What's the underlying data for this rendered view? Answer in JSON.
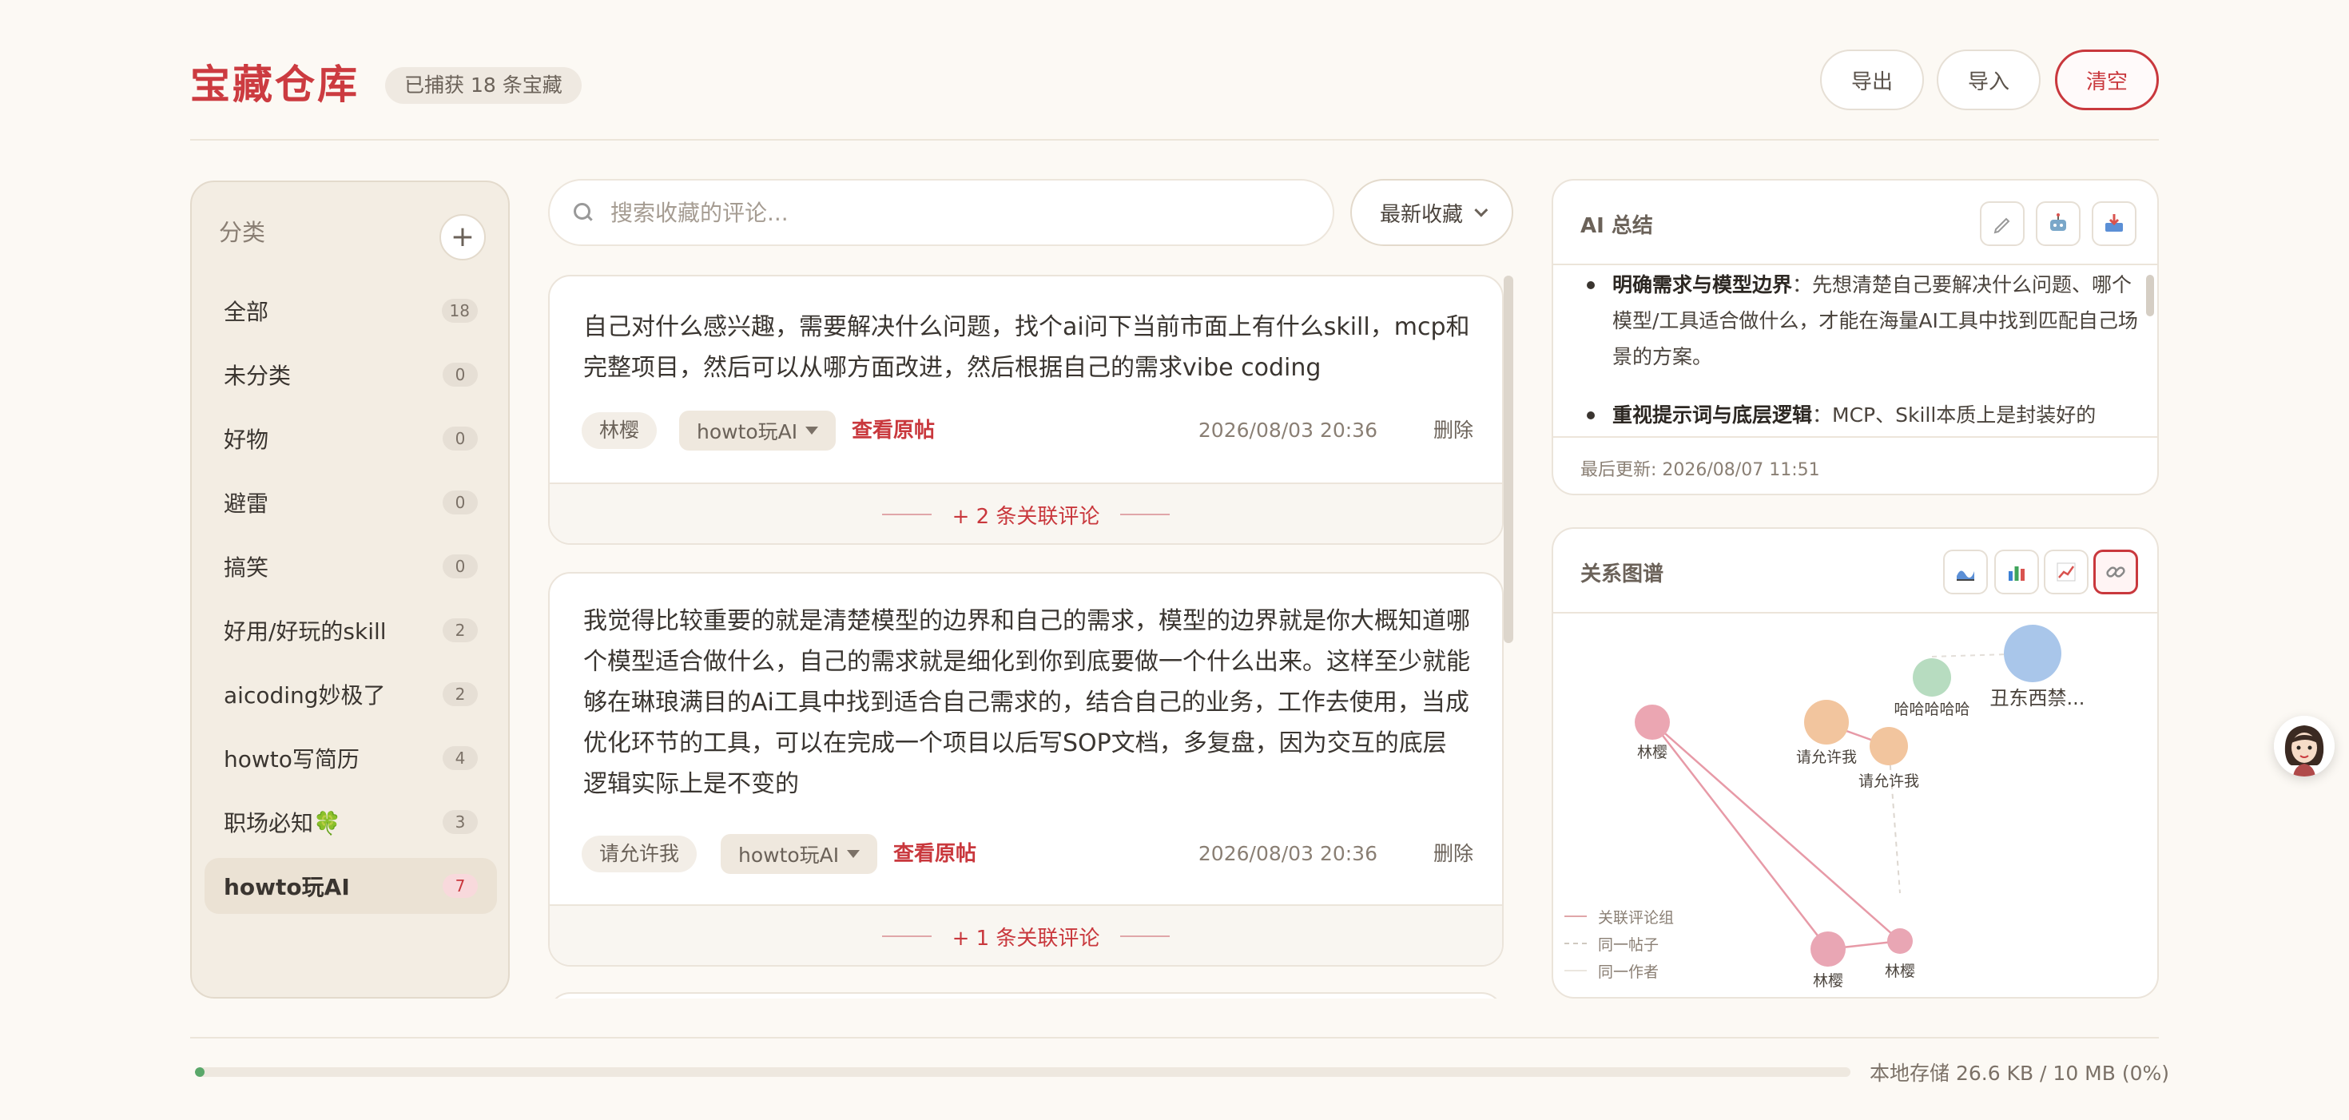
{
  "header": {
    "title": "宝藏仓库",
    "count_badge": "已捕获 18 条宝藏",
    "export_label": "导出",
    "import_label": "导入",
    "clear_label": "清空"
  },
  "sidebar": {
    "heading": "分类",
    "add_label": "+",
    "items": [
      {
        "label": "全部",
        "count": "18"
      },
      {
        "label": "未分类",
        "count": "0"
      },
      {
        "label": "好物",
        "count": "0"
      },
      {
        "label": "避雷",
        "count": "0"
      },
      {
        "label": "搞笑",
        "count": "0"
      },
      {
        "label": "好用/好玩的skill",
        "count": "2"
      },
      {
        "label": "aicoding妙极了",
        "count": "2"
      },
      {
        "label": "howto写简历",
        "count": "4"
      },
      {
        "label": "职场必知🍀",
        "count": "3"
      },
      {
        "label": "howto玩AI",
        "count": "7"
      }
    ],
    "active_index": 9
  },
  "search": {
    "placeholder": "搜索收藏的评论...",
    "value": ""
  },
  "sort": {
    "selected": "最新收藏"
  },
  "cards": [
    {
      "text": "自己对什么感兴趣，需要解决什么问题，找个ai问下当前市面上有什么skill，mcp和完整项目，然后可以从哪方面改进，然后根据自己的需求vibe coding",
      "author": "林樱",
      "category": "howto玩AI",
      "view_label": "查看原帖",
      "time": "2026/08/03 20:36",
      "delete_label": "删除",
      "related_label": "+ 2 条关联评论"
    },
    {
      "text": "我觉得比较重要的就是清楚模型的边界和自己的需求，模型的边界就是你大概知道哪个模型适合做什么，自己的需求就是细化到你到底要做一个什么出来。这样至少就能够在琳琅满目的Ai工具中找到适合自己需求的，结合自己的业务，工作去使用，当成优化环节的工具，可以在完成一个项目以后写SOP文档，多复盘，因为交互的底层逻辑实际上是不变的",
      "author": "请允许我",
      "category": "howto玩AI",
      "view_label": "查看原帖",
      "time": "2026/08/03 20:36",
      "delete_label": "删除",
      "related_label": "+ 1 条关联评论"
    }
  ],
  "ai_summary": {
    "title": "AI 总结",
    "icons": [
      "pencil-icon",
      "robot-icon",
      "inbox-icon"
    ],
    "bullets": [
      {
        "bold": "明确需求与模型边界",
        "text": "：先想清楚自己要解决什么问题、哪个模型/工具适合做什么，才能在海量AI工具中找到匹配自己场景的方案。"
      },
      {
        "bold": "重视提示词与底层逻辑",
        "text": "：MCP、Skill本质上是封装好的"
      }
    ],
    "updated": "最后更新: 2026/08/07 11:51"
  },
  "graph": {
    "title": "关系图谱",
    "icons": [
      "wave-icon",
      "bar-chart-icon",
      "line-chart-icon",
      "link-icon"
    ],
    "selected_icon": 3,
    "nodes": [
      {
        "label": "丑东西禁...",
        "color": "#a9c6ea"
      },
      {
        "label": "哈哈哈哈哈",
        "color": "#b7dcc0"
      },
      {
        "label": "林樱",
        "color": "#eba6b2"
      },
      {
        "label": "请允许我",
        "color": "#f2c59e"
      },
      {
        "label": "请允许我",
        "color": "#f2c59e"
      },
      {
        "label": "林樱",
        "color": "#e9a6b4"
      },
      {
        "label": "林樱",
        "color": "#e9a6b4"
      }
    ],
    "legend": [
      "关联评论组",
      "同一帖子",
      "同一作者"
    ]
  },
  "footer": {
    "storage_label": "本地存储 26.6 KB / 10 MB (0%)",
    "progress_percent": 0.6
  },
  "colors": {
    "accent": "#c9383d",
    "background": "#fcf9f4",
    "progress": "#5aa86a"
  }
}
